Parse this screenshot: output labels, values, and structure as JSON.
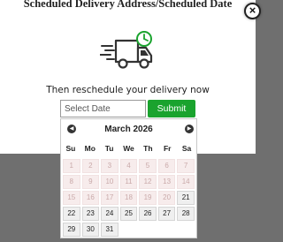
{
  "modal": {
    "title": "Scheduled Delivery Address/Scheduled Date",
    "close_label": "×",
    "prompt": "Then reschedule your delivery now",
    "date_placeholder": "Select Date",
    "submit_label": "Submit"
  },
  "colors": {
    "accent": "#1aa32e",
    "disabled_day_bg": "#f7ecec",
    "disabled_day_text": "#c9a9a9",
    "active_day_bg": "#efefef"
  },
  "icons": {
    "truck": "delivery-truck-clock-icon",
    "prev": "chevron-left-icon",
    "next": "chevron-right-icon"
  },
  "calendar": {
    "month_label": "March 2026",
    "prev_glyph": "◀",
    "next_glyph": "▶",
    "weekdays": [
      "Su",
      "Mo",
      "Tu",
      "We",
      "Th",
      "Fr",
      "Sa"
    ],
    "weeks": [
      [
        {
          "d": "1",
          "enabled": false
        },
        {
          "d": "2",
          "enabled": false
        },
        {
          "d": "3",
          "enabled": false
        },
        {
          "d": "4",
          "enabled": false
        },
        {
          "d": "5",
          "enabled": false
        },
        {
          "d": "6",
          "enabled": false
        },
        {
          "d": "7",
          "enabled": false
        }
      ],
      [
        {
          "d": "8",
          "enabled": false
        },
        {
          "d": "9",
          "enabled": false
        },
        {
          "d": "10",
          "enabled": false
        },
        {
          "d": "11",
          "enabled": false
        },
        {
          "d": "12",
          "enabled": false
        },
        {
          "d": "13",
          "enabled": false
        },
        {
          "d": "14",
          "enabled": false
        }
      ],
      [
        {
          "d": "15",
          "enabled": false
        },
        {
          "d": "16",
          "enabled": false
        },
        {
          "d": "17",
          "enabled": false
        },
        {
          "d": "18",
          "enabled": false
        },
        {
          "d": "19",
          "enabled": false
        },
        {
          "d": "20",
          "enabled": false
        },
        {
          "d": "21",
          "enabled": true
        }
      ],
      [
        {
          "d": "22",
          "enabled": true
        },
        {
          "d": "23",
          "enabled": true
        },
        {
          "d": "24",
          "enabled": true
        },
        {
          "d": "25",
          "enabled": true
        },
        {
          "d": "26",
          "enabled": true
        },
        {
          "d": "27",
          "enabled": true
        },
        {
          "d": "28",
          "enabled": true
        }
      ],
      [
        {
          "d": "29",
          "enabled": true
        },
        {
          "d": "30",
          "enabled": true
        },
        {
          "d": "31",
          "enabled": true
        }
      ]
    ]
  }
}
